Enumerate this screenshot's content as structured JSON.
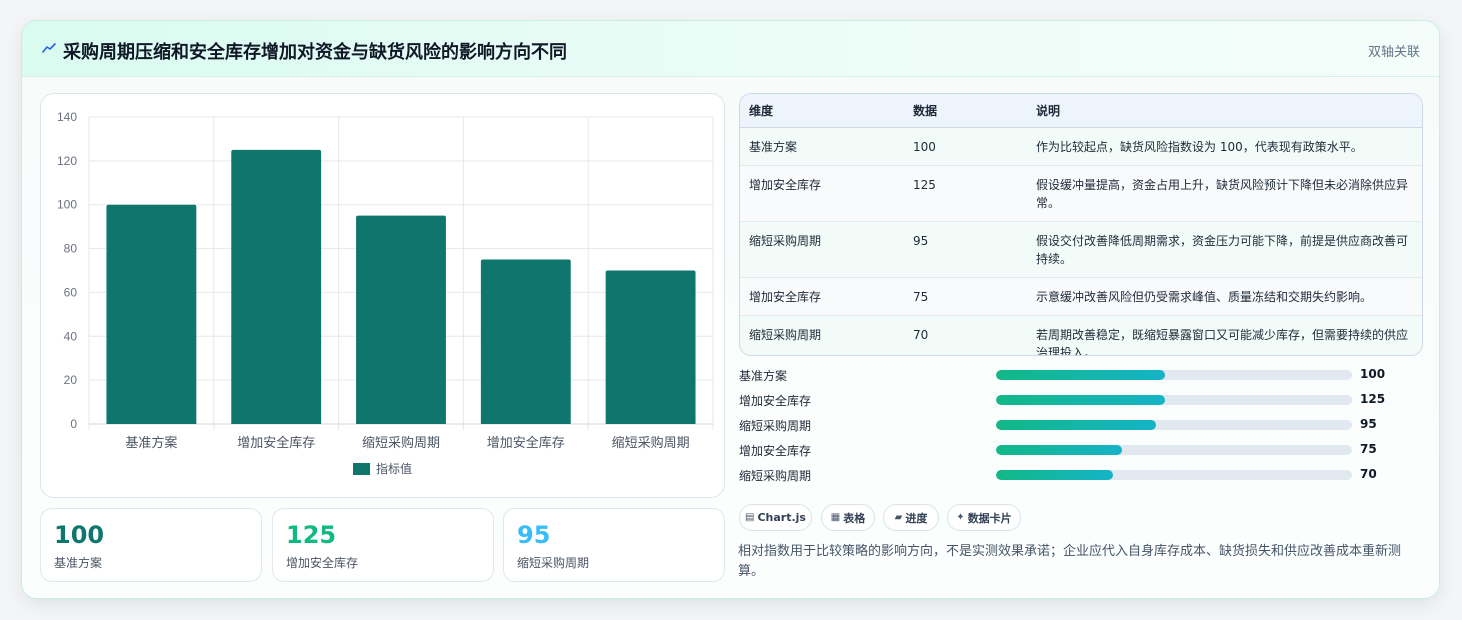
{
  "header": {
    "title": "采购周期压缩和安全库存增加对资金与缺货风险的影响方向不同",
    "tag": "双轴关联",
    "icon": "trend-line-icon"
  },
  "chart_data": {
    "type": "bar",
    "categories": [
      "基准方案",
      "增加安全库存",
      "缩短采购周期",
      "增加安全库存",
      "缩短采购周期"
    ],
    "series": [
      {
        "name": "指标值",
        "values": [
          100,
          125,
          95,
          75,
          70
        ],
        "color": "#0f766e"
      }
    ],
    "ylim": [
      0,
      140
    ],
    "yticks": [
      "0",
      "20",
      "40",
      "60",
      "80",
      "100",
      "120",
      "140"
    ],
    "grid": true,
    "legend_position": "bottom",
    "title": "",
    "xlabel": "",
    "ylabel": ""
  },
  "stats": [
    {
      "value": "100",
      "label": "基准方案",
      "color": "#0f766e"
    },
    {
      "value": "125",
      "label": "增加安全库存",
      "color": "#10b981"
    },
    {
      "value": "95",
      "label": "缩短采购周期",
      "color": "#38bdf8"
    }
  ],
  "table": {
    "headers": [
      "维度",
      "数据",
      "说明"
    ],
    "rows": [
      [
        "基准方案",
        "100",
        "作为比较起点，缺货风险指数设为 100，代表现有政策水平。"
      ],
      [
        "增加安全库存",
        "125",
        "假设缓冲量提高，资金占用上升，缺货风险预计下降但未必消除供应异常。"
      ],
      [
        "缩短采购周期",
        "95",
        "假设交付改善降低周期需求，资金压力可能下降，前提是供应商改善可持续。"
      ],
      [
        "增加安全库存",
        "75",
        "示意缓冲改善风险但仍受需求峰值、质量冻结和交期失约影响。"
      ],
      [
        "缩短采购周期",
        "70",
        "若周期改善稳定，既缩短暴露窗口又可能减少库存，但需要持续的供应治理投入。"
      ]
    ]
  },
  "progress": [
    {
      "label": "基准方案",
      "value": "100",
      "fill": 0.475
    },
    {
      "label": "增加安全库存",
      "value": "125",
      "fill": 0.475
    },
    {
      "label": "缩短采购周期",
      "value": "95",
      "fill": 0.45
    },
    {
      "label": "增加安全库存",
      "value": "75",
      "fill": 0.355
    },
    {
      "label": "缩短采购周期",
      "value": "70",
      "fill": 0.33
    }
  ],
  "chips": [
    {
      "icon": "chart-icon",
      "glyph": "▤",
      "label": "Chart.js"
    },
    {
      "icon": "table-icon",
      "glyph": "▦",
      "label": "表格"
    },
    {
      "icon": "progress-icon",
      "glyph": "▰",
      "label": "进度"
    },
    {
      "icon": "card-icon",
      "glyph": "✦",
      "label": "数据卡片"
    }
  ],
  "note": "相对指数用于比较策略的影响方向，不是实测效果承诺；企业应代入自身库存成本、缺货损失和供应改善成本重新测算。"
}
